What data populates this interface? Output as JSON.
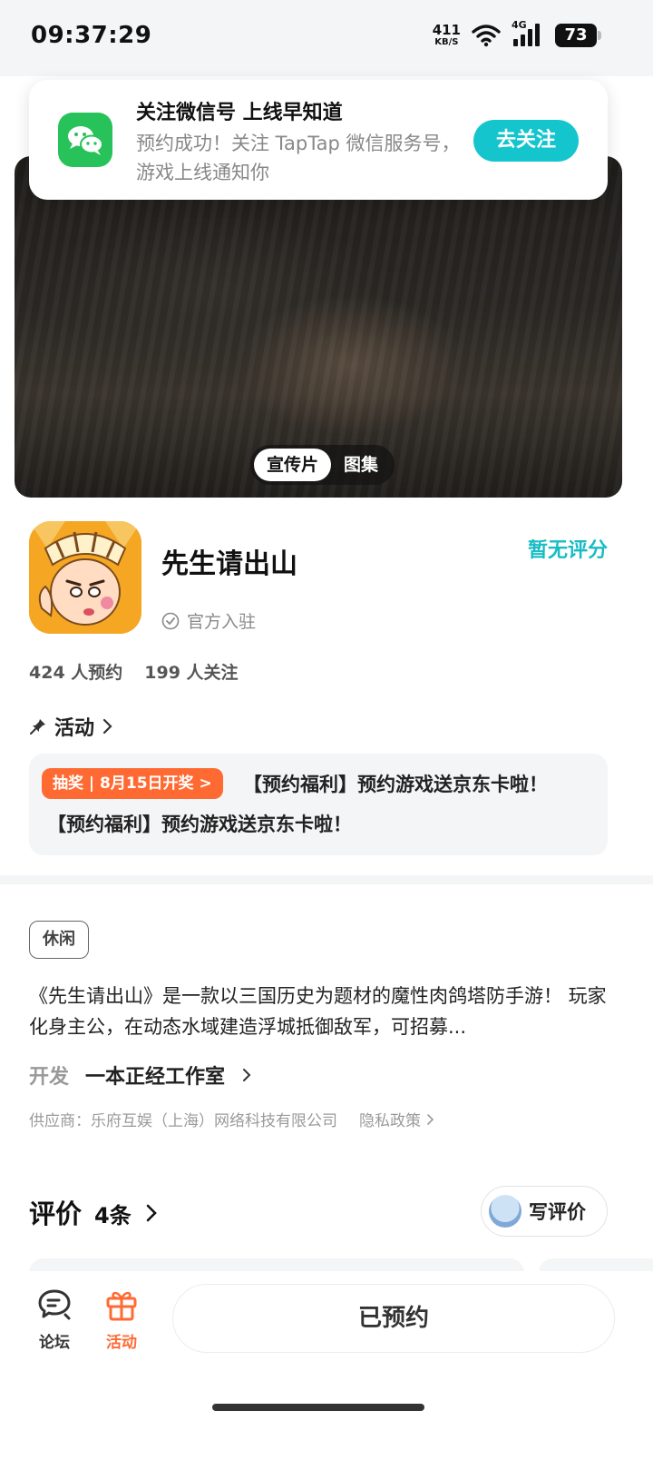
{
  "status_bar": {
    "time": "09:37:29",
    "net_speed_value": "411",
    "net_speed_unit": "KB/S",
    "network": "4G",
    "battery": "73"
  },
  "banner": {
    "title": "关注微信号 上线早知道",
    "description": "预约成功！关注 TapTap 微信服务号，游戏上线通知你",
    "follow_button": "去关注",
    "icon": "wechat-icon"
  },
  "media": {
    "tabs": [
      "宣传片",
      "图集"
    ],
    "active_tab": "宣传片"
  },
  "game": {
    "name": "先生请出山",
    "official_label": "官方入驻",
    "rating": "暂无评分",
    "reservations": "424 人预约",
    "followers": "199 人关注"
  },
  "activity": {
    "header": "活动",
    "badge": "抽奖 | 8月15日开奖 >",
    "line1": "【预约福利】预约游戏送京东卡啦！",
    "line2": "【预约福利】预约游戏送京东卡啦！"
  },
  "details": {
    "tag": "休闲",
    "description": "《先生请出山》是一款以三国历史为题材的魔性肉鸽塔防手游！ 玩家化身主公，在动态水域建造浮城抵御敌军，可招募...",
    "developer_label": "开发",
    "developer_name": "一本正经工作室",
    "supplier": "供应商：乐府互娱（上海）网络科技有限公司",
    "privacy": "隐私政策"
  },
  "reviews": {
    "title": "评价",
    "count": "4条",
    "write_button": "写评价"
  },
  "bottom_bar": {
    "forum_label": "论坛",
    "activity_label": "活动",
    "reserved_button": "已预约"
  },
  "colors": {
    "accent_teal": "#15c5ce",
    "accent_orange": "#ff6a33",
    "wechat_green": "#27c25a"
  }
}
